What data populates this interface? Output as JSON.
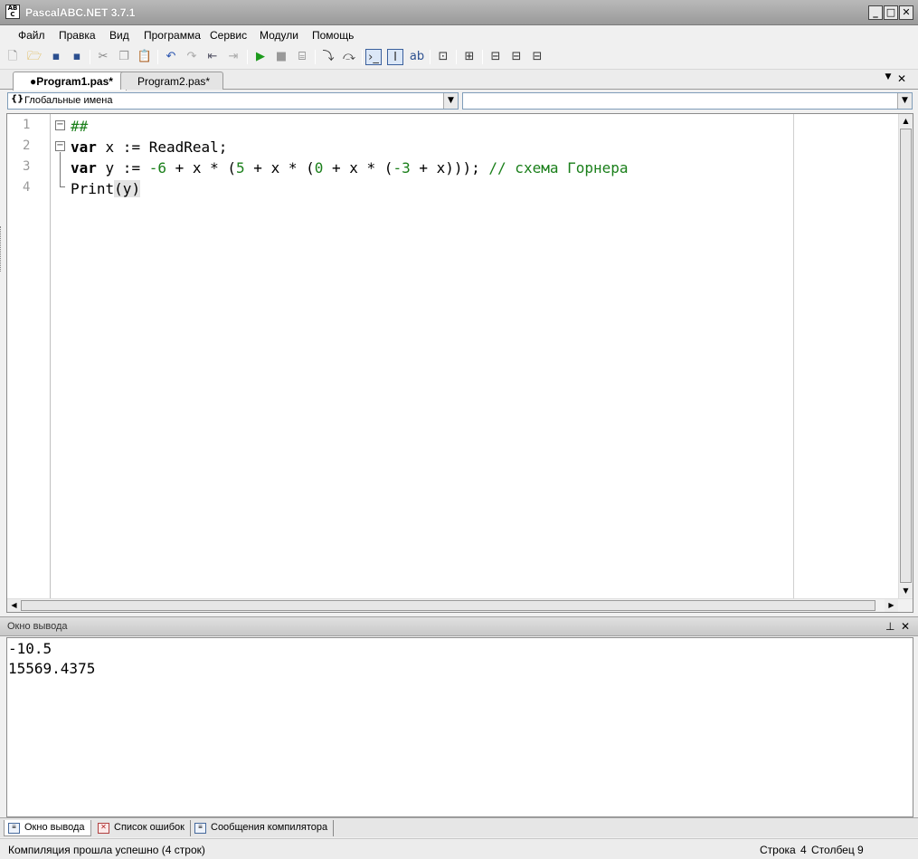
{
  "window": {
    "title": "PascalABC.NET 3.7.1",
    "controls": {
      "minimize": "_",
      "maximize": "□",
      "close": "✕"
    }
  },
  "menu": [
    "Файл",
    "Правка",
    "Вид",
    "Программа",
    "Сервис",
    "Модули",
    "Помощь"
  ],
  "tabs": [
    {
      "label": "●Program1.pas*",
      "active": true
    },
    {
      "label": "Program2.pas*",
      "active": false
    }
  ],
  "tab_controls": {
    "dropdown": "▼",
    "close": "✕"
  },
  "combos": {
    "scope_icon": "{}",
    "scope_value": "Глобальные имена",
    "member_value": "",
    "arrow": "▼"
  },
  "editor": {
    "line_numbers": [
      "1",
      "2",
      "3",
      "4"
    ],
    "lines": [
      {
        "text": "##",
        "tokens": [
          {
            "t": "##",
            "c": "cm"
          }
        ]
      },
      {
        "text": "var x := ReadReal;",
        "tokens": [
          {
            "t": "var",
            "c": "kw"
          },
          {
            "t": " x := ReadReal;",
            "c": ""
          }
        ]
      },
      {
        "text": "var y := -6 + x * (5 + x * (0 + x * (-3 + x))); // схема Горнера",
        "tokens": [
          {
            "t": "var",
            "c": "kw"
          },
          {
            "t": " y := ",
            "c": ""
          },
          {
            "t": "-6",
            "c": "num"
          },
          {
            "t": " + x * (",
            "c": ""
          },
          {
            "t": "5",
            "c": "num"
          },
          {
            "t": " + x * (",
            "c": ""
          },
          {
            "t": "0",
            "c": "num"
          },
          {
            "t": " + x * (",
            "c": ""
          },
          {
            "t": "-3",
            "c": "num"
          },
          {
            "t": " + x))); ",
            "c": ""
          },
          {
            "t": "// схема Горнера",
            "c": "cm"
          }
        ]
      },
      {
        "text": "Print(y)",
        "tokens": [
          {
            "t": "Print",
            "c": ""
          },
          {
            "t": "(y)",
            "c": "hl"
          }
        ]
      }
    ]
  },
  "output_panel": {
    "title": "Окно вывода",
    "pin": "⊥",
    "close": "✕",
    "lines": [
      "-10.5",
      "15569.4375"
    ]
  },
  "bottom_tabs": [
    {
      "label": "Окно вывода",
      "active": true
    },
    {
      "label": "Список ошибок",
      "active": false
    },
    {
      "label": "Сообщения компилятора",
      "active": false
    }
  ],
  "status": {
    "message": "Компиляция прошла успешно (4 строк)",
    "row_label": "Строка",
    "row": "4",
    "col_label": "Столбец",
    "col": "9"
  }
}
